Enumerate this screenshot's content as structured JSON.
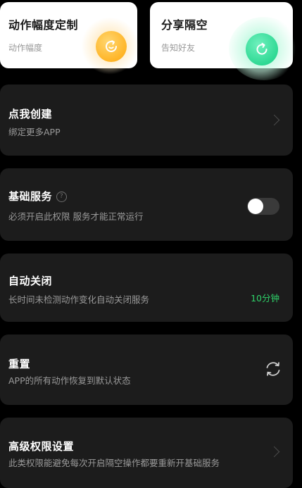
{
  "top_cards": [
    {
      "title": "动作幅度定制",
      "subtitle": "动作幅度",
      "icon": "smile-refresh-icon",
      "color": "#FFB527"
    },
    {
      "title": "分享隔空",
      "subtitle": "告知好友",
      "icon": "share-refresh-icon",
      "color": "#2FD994"
    }
  ],
  "rows": {
    "create": {
      "title": "点我创建",
      "subtitle": "绑定更多APP",
      "icon": "chevron-right-icon"
    },
    "basic_service": {
      "title": "基础服务",
      "help_icon": "?",
      "subtitle": "必须开启此权限 服务才能正常运行",
      "toggle_on": false
    },
    "auto_close": {
      "title": "自动关闭",
      "subtitle": "长时间未检测动作变化自动关闭服务",
      "value": "10分钟",
      "value_color": "#2FD36A"
    },
    "reset": {
      "title": "重置",
      "subtitle": "APP的所有动作恢复到默认状态",
      "icon": "refresh-icon"
    },
    "advanced": {
      "title": "高级权限设置",
      "subtitle": "此类权限能避免每次开启隔空操作都要重新开基础服务",
      "icon": "chevron-right-icon"
    }
  }
}
